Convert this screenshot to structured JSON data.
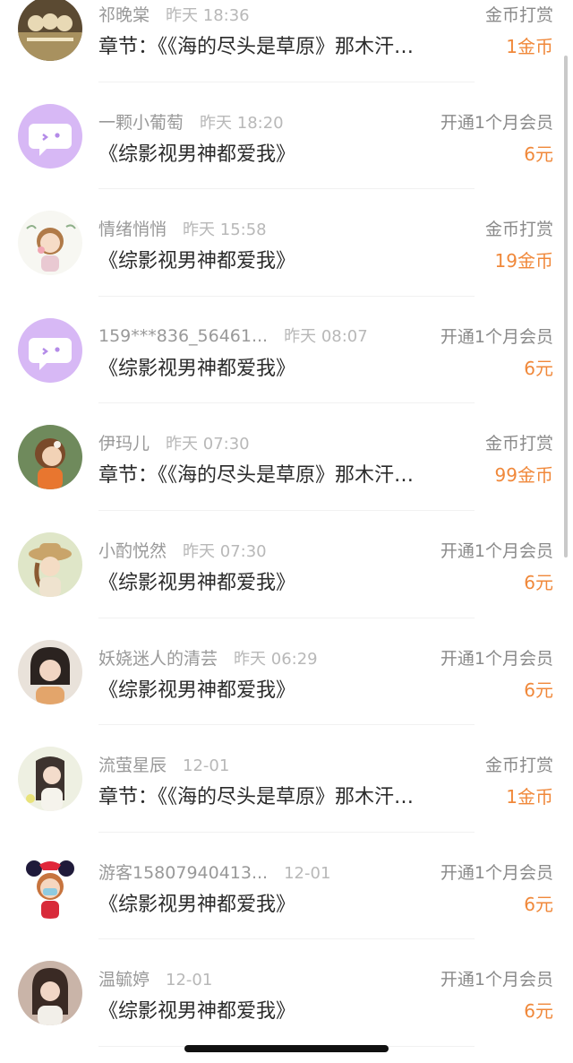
{
  "records": [
    {
      "name": "祁晚棠",
      "time": "昨天 18:36",
      "title": "章节：《《海的尽头是草原》那木汗…",
      "type": "金币打赏",
      "amount": "1金币",
      "avatar_icon": "photo-avatar-icon"
    },
    {
      "name": "一颗小葡萄",
      "time": "昨天 18:20",
      "title": "《综影视男神都爱我》",
      "type": "开通1个月会员",
      "amount": "6元",
      "avatar_icon": "default-chat-avatar-icon"
    },
    {
      "name": "情绪悄悄",
      "time": "昨天 15:58",
      "title": "《综影视男神都爱我》",
      "type": "金币打赏",
      "amount": "19金币",
      "avatar_icon": "illustrated-girl-avatar-icon"
    },
    {
      "name": "159***836_56461...",
      "time": "昨天 08:07",
      "title": "《综影视男神都爱我》",
      "type": "开通1个月会员",
      "amount": "6元",
      "avatar_icon": "default-chat-avatar-icon"
    },
    {
      "name": "伊玛儿",
      "time": "昨天 07:30",
      "title": "章节：《《海的尽头是草原》那木汗…",
      "type": "金币打赏",
      "amount": "99金币",
      "avatar_icon": "illustrated-girl-avatar-icon"
    },
    {
      "name": "小酌悦然",
      "time": "昨天 07:30",
      "title": "《综影视男神都爱我》",
      "type": "开通1个月会员",
      "amount": "6元",
      "avatar_icon": "illustrated-girl-avatar-icon"
    },
    {
      "name": "妖娆迷人的清芸",
      "time": "昨天 06:29",
      "title": "《综影视男神都爱我》",
      "type": "开通1个月会员",
      "amount": "6元",
      "avatar_icon": "photo-avatar-icon"
    },
    {
      "name": "流萤星辰",
      "time": "12-01",
      "title": "章节：《《海的尽头是草原》那木汗…",
      "type": "金币打赏",
      "amount": "1金币",
      "avatar_icon": "illustrated-girl-avatar-icon"
    },
    {
      "name": "游客15807940413...",
      "time": "12-01",
      "title": "《综影视男神都爱我》",
      "type": "开通1个月会员",
      "amount": "6元",
      "avatar_icon": "cartoon-mouse-ears-avatar-icon"
    },
    {
      "name": "温毓婷",
      "time": "12-01",
      "title": "《综影视男神都爱我》",
      "type": "开通1个月会员",
      "amount": "6元",
      "avatar_icon": "photo-avatar-icon"
    }
  ],
  "colors": {
    "accent": "#f0883a",
    "default_avatar": "#d7b8f5"
  }
}
